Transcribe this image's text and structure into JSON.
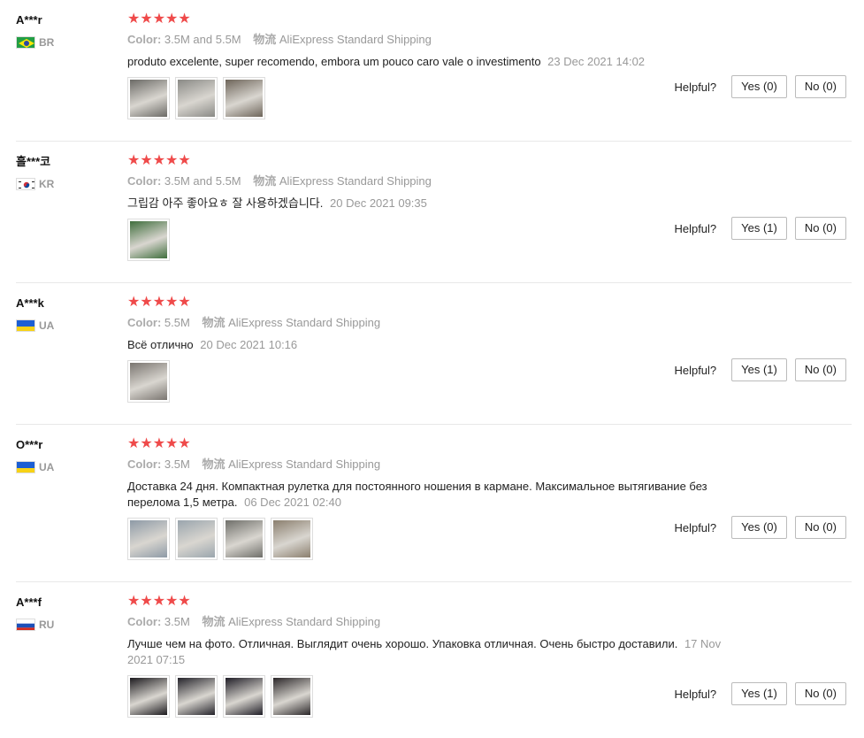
{
  "reviews": [
    {
      "name": "A***r",
      "country": "BR",
      "stars": "★★★★★",
      "color_label": "Color:",
      "color_value": "3.5M and 5.5M",
      "logistics_label": "物流",
      "logistics_value": "AliExpress Standard Shipping",
      "text": "produto excelente, super recomendo, embora um pouco caro vale o investimento",
      "date": "23 Dec 2021 14:02",
      "helpful_label": "Helpful?",
      "yes": "Yes (0)",
      "no": "No (0)",
      "photos": 3
    },
    {
      "name": "흘***코",
      "country": "KR",
      "stars": "★★★★★",
      "color_label": "Color:",
      "color_value": "3.5M and 5.5M",
      "logistics_label": "物流",
      "logistics_value": "AliExpress Standard Shipping",
      "text": "그립감 아주 좋아요ㅎ 잘 사용하겠습니다.",
      "date": "20 Dec 2021 09:35",
      "helpful_label": "Helpful?",
      "yes": "Yes (1)",
      "no": "No (0)",
      "photos": 1
    },
    {
      "name": "A***k",
      "country": "UA",
      "stars": "★★★★★",
      "color_label": "Color:",
      "color_value": "5.5M",
      "logistics_label": "物流",
      "logistics_value": "AliExpress Standard Shipping",
      "text": "Всё отлично",
      "date": "20 Dec 2021 10:16",
      "helpful_label": "Helpful?",
      "yes": "Yes (1)",
      "no": "No (0)",
      "photos": 1
    },
    {
      "name": "O***r",
      "country": "UA",
      "stars": "★★★★★",
      "color_label": "Color:",
      "color_value": "3.5M",
      "logistics_label": "物流",
      "logistics_value": "AliExpress Standard Shipping",
      "text": "Доставка 24 дня. Компактная рулетка для постоянного ношения в кармане. Максимальное вытягивание без перелома 1,5 метра.",
      "date": "06 Dec 2021 02:40",
      "helpful_label": "Helpful?",
      "yes": "Yes (0)",
      "no": "No (0)",
      "photos": 4
    },
    {
      "name": "A***f",
      "country": "RU",
      "stars": "★★★★★",
      "color_label": "Color:",
      "color_value": "3.5M",
      "logistics_label": "物流",
      "logistics_value": "AliExpress Standard Shipping",
      "text": "Лучше чем на фото. Отличная. Выглядит очень хорошо. Упаковка отличная. Очень быстро доставили.",
      "date": "17 Nov 2021 07:15",
      "helpful_label": "Helpful?",
      "yes": "Yes (1)",
      "no": "No (0)",
      "photos": 4
    }
  ],
  "colors": {
    "star": "#ef4a4a",
    "muted": "#999999",
    "border": "#e8e8e8"
  }
}
